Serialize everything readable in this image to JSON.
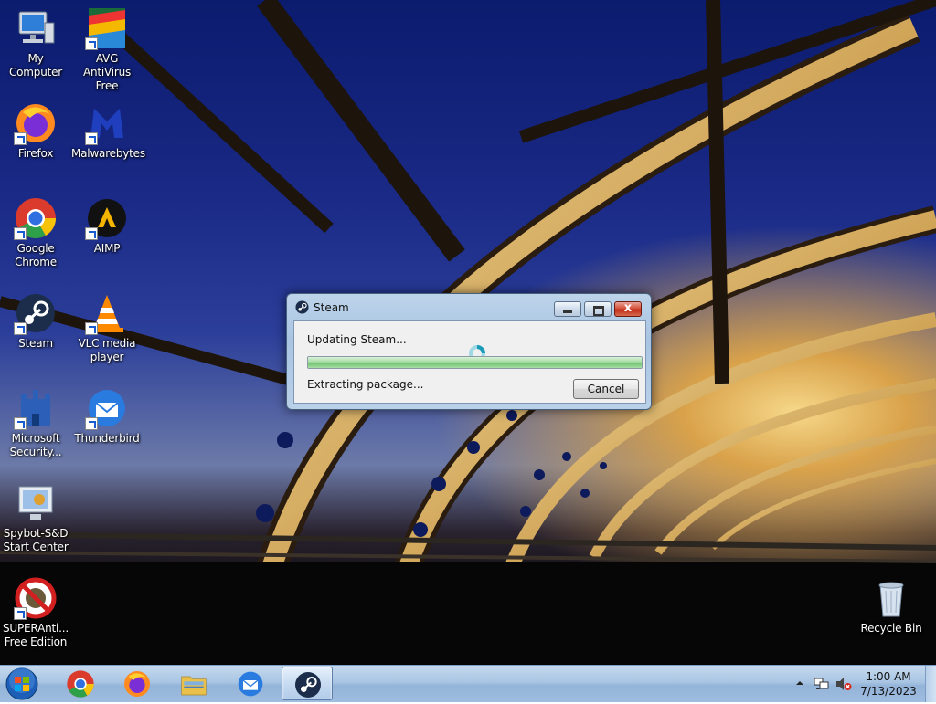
{
  "desktop": {
    "icons": [
      {
        "label": "My Computer",
        "icon": "computer-icon"
      },
      {
        "label": "AVG AntiVirus Free",
        "icon": "avg-icon"
      },
      {
        "label": "Firefox",
        "icon": "firefox-icon"
      },
      {
        "label": "Malwarebytes",
        "icon": "malwarebytes-icon"
      },
      {
        "label": "Google Chrome",
        "icon": "chrome-icon"
      },
      {
        "label": "AIMP",
        "icon": "aimp-icon"
      },
      {
        "label": "Steam",
        "icon": "steam-icon"
      },
      {
        "label": "VLC media player",
        "icon": "vlc-icon"
      },
      {
        "label": "Microsoft Security...",
        "icon": "microsoft-security-icon"
      },
      {
        "label": "Thunderbird",
        "icon": "thunderbird-icon"
      },
      {
        "label": "Spybot-S&D Start Center",
        "icon": "spybot-icon"
      },
      {
        "label": "SUPERAnti... Free Edition",
        "icon": "superantispyware-icon"
      },
      {
        "label": "Recycle Bin",
        "icon": "recycle-bin-icon"
      }
    ]
  },
  "dialog": {
    "title": "Steam",
    "status_line1": "Updating Steam...",
    "status_line2": "Extracting package...",
    "progress": 1.0,
    "cancel_label": "Cancel",
    "close_glyph": "x"
  },
  "taskbar": {
    "pinned": [
      {
        "name": "chrome",
        "icon": "chrome-icon"
      },
      {
        "name": "firefox",
        "icon": "firefox-icon"
      },
      {
        "name": "explorer",
        "icon": "folder-icon"
      },
      {
        "name": "thunderbird",
        "icon": "thunderbird-icon"
      },
      {
        "name": "steam",
        "icon": "steam-icon",
        "active": true
      }
    ],
    "clock": {
      "time": "1:00 AM",
      "date": "7/13/2023"
    }
  },
  "colors": {
    "sky_top": "#0b1b6e",
    "bridge_gold": "#e8c36a",
    "progress_green": "#6fc36f",
    "taskbar": "#a9c5e3"
  }
}
